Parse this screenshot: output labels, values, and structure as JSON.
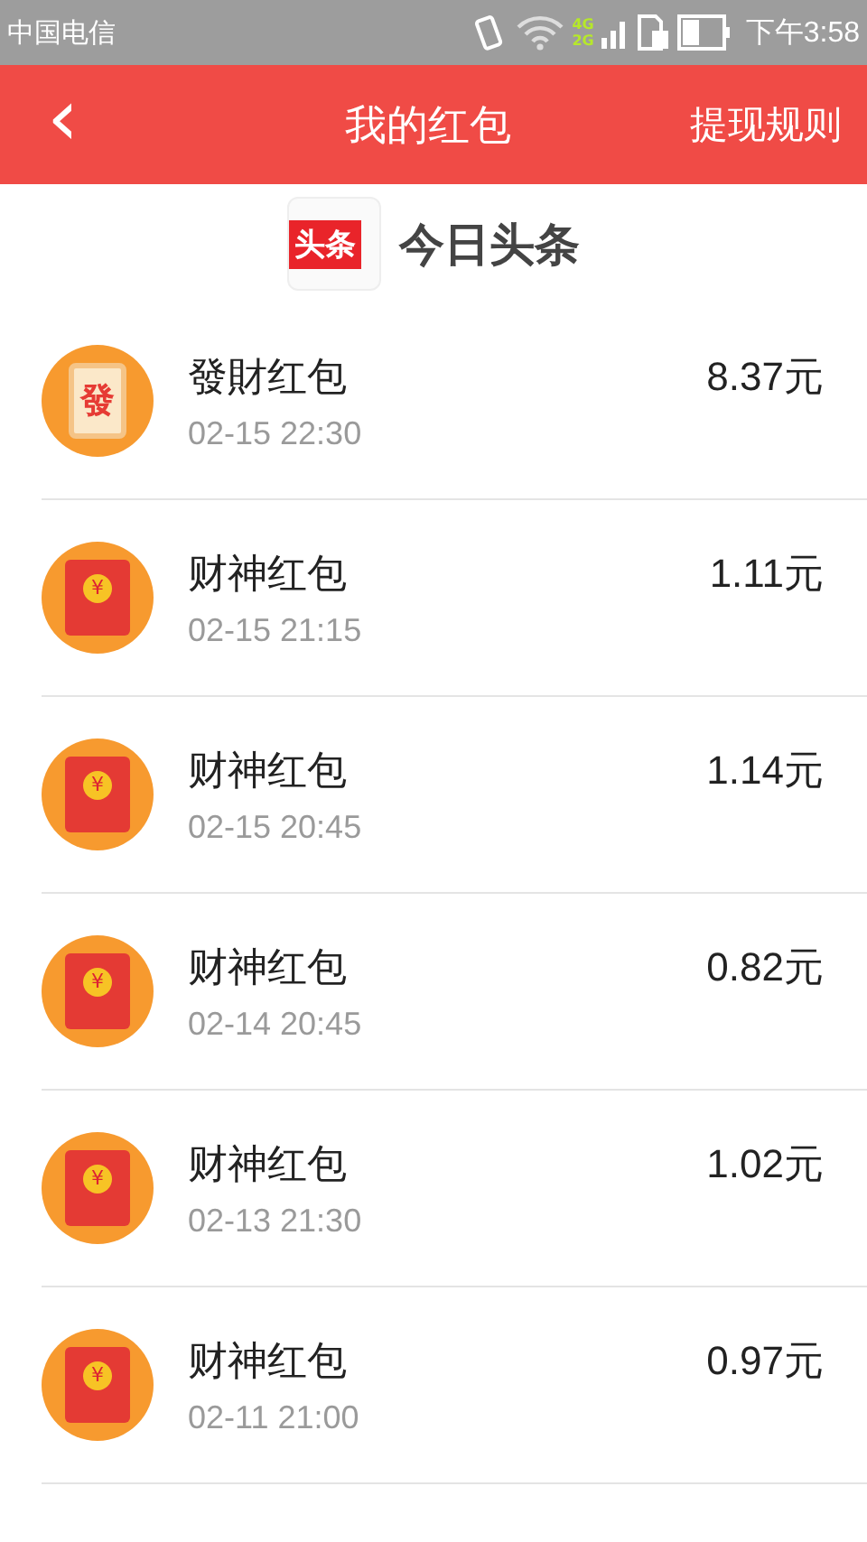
{
  "status_bar": {
    "carrier": "中国电信",
    "network_top": "4G",
    "network_bottom": "2G",
    "time": "下午3:58"
  },
  "header": {
    "back": "‹",
    "title": "我的红包",
    "action": "提现规则"
  },
  "brand": {
    "badge": "头条",
    "name": "今日头条"
  },
  "packets": [
    {
      "kind": "fa",
      "glyph": "發",
      "title": "發財红包",
      "time": "02-15 22:30",
      "amount": "8.37元"
    },
    {
      "kind": "coin",
      "glyph": "¥",
      "title": "财神红包",
      "time": "02-15 21:15",
      "amount": "1.11元"
    },
    {
      "kind": "coin",
      "glyph": "¥",
      "title": "财神红包",
      "time": "02-15 20:45",
      "amount": "1.14元"
    },
    {
      "kind": "coin",
      "glyph": "¥",
      "title": "财神红包",
      "time": "02-14 20:45",
      "amount": "0.82元"
    },
    {
      "kind": "coin",
      "glyph": "¥",
      "title": "财神红包",
      "time": "02-13 21:30",
      "amount": "1.02元"
    },
    {
      "kind": "coin",
      "glyph": "¥",
      "title": "财神红包",
      "time": "02-11 21:00",
      "amount": "0.97元"
    }
  ]
}
